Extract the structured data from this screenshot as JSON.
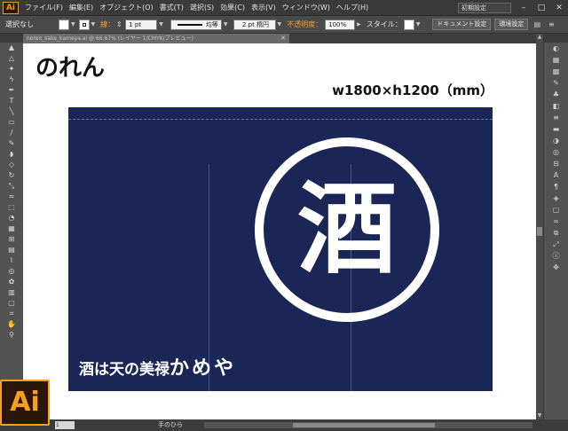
{
  "app": {
    "logo": "Ai"
  },
  "menubar": {
    "items": [
      "ファイル(F)",
      "編集(E)",
      "オブジェクト(O)",
      "書式(T)",
      "選択(S)",
      "効果(C)",
      "表示(V)",
      "ウィンドウ(W)",
      "ヘルプ(H)"
    ],
    "workspace": "初期設定",
    "minimize": "–",
    "maximize": "□",
    "close": "✕"
  },
  "controlbar": {
    "selection_status": "選択なし",
    "stroke_label": "線：",
    "stroke_weight": "1 pt",
    "brush_style": "均等",
    "brush_profile": "2 pt 楕円",
    "opacity_label": "不透明度：",
    "opacity_value": "100%",
    "style_label": "スタイル：",
    "document_setup": "ドキュメント設定",
    "preferences": "環境設定"
  },
  "document": {
    "tab_title": "noren_sake_kameya.ai @ 66.67% (レイヤー 1/CMYK/プレビュー)",
    "artboard_title": "のれん",
    "size_label": "w1800×h1200（mm）",
    "noren": {
      "emblem_char": "酒",
      "slogan": "酒は天の美禄",
      "shop_name": "かめや",
      "cloth_color": "#1a2756"
    }
  },
  "statusbar": {
    "zoom": "1",
    "current_tool": "手のひら"
  },
  "toolbox": {
    "tools": [
      {
        "name": "selection-tool-icon",
        "glyph": "▲"
      },
      {
        "name": "direct-selection-tool-icon",
        "glyph": "△"
      },
      {
        "name": "magic-wand-tool-icon",
        "glyph": "✦"
      },
      {
        "name": "lasso-tool-icon",
        "glyph": "ϟ"
      },
      {
        "name": "pen-tool-icon",
        "glyph": "✒"
      },
      {
        "name": "type-tool-icon",
        "glyph": "T"
      },
      {
        "name": "line-tool-icon",
        "glyph": "╲"
      },
      {
        "name": "rectangle-tool-icon",
        "glyph": "▭"
      },
      {
        "name": "paintbrush-tool-icon",
        "glyph": "∕"
      },
      {
        "name": "pencil-tool-icon",
        "glyph": "✎"
      },
      {
        "name": "blob-brush-tool-icon",
        "glyph": "◗"
      },
      {
        "name": "eraser-tool-icon",
        "glyph": "◇"
      },
      {
        "name": "rotate-tool-icon",
        "glyph": "↻"
      },
      {
        "name": "scale-tool-icon",
        "glyph": "⤡"
      },
      {
        "name": "warp-tool-icon",
        "glyph": "≈"
      },
      {
        "name": "free-transform-tool-icon",
        "glyph": "⬚"
      },
      {
        "name": "shape-builder-tool-icon",
        "glyph": "◔"
      },
      {
        "name": "perspective-grid-tool-icon",
        "glyph": "▦"
      },
      {
        "name": "mesh-tool-icon",
        "glyph": "⊞"
      },
      {
        "name": "gradient-tool-icon",
        "glyph": "▤"
      },
      {
        "name": "eyedropper-tool-icon",
        "glyph": "⌇"
      },
      {
        "name": "blend-tool-icon",
        "glyph": "◎"
      },
      {
        "name": "symbol-sprayer-tool-icon",
        "glyph": "✿"
      },
      {
        "name": "column-graph-tool-icon",
        "glyph": "▥"
      },
      {
        "name": "artboard-tool-icon",
        "glyph": "▢"
      },
      {
        "name": "slice-tool-icon",
        "glyph": "⌗"
      },
      {
        "name": "hand-tool-icon",
        "glyph": "✋"
      },
      {
        "name": "zoom-tool-icon",
        "glyph": "⚲"
      }
    ]
  },
  "rightpanel": {
    "icons": [
      {
        "name": "color-panel-icon",
        "glyph": "◐"
      },
      {
        "name": "color-guide-panel-icon",
        "glyph": "▦"
      },
      {
        "name": "swatches-panel-icon",
        "glyph": "▩"
      },
      {
        "name": "brushes-panel-icon",
        "glyph": "✎"
      },
      {
        "name": "symbols-panel-icon",
        "glyph": "♣"
      },
      {
        "name": "graphic-styles-panel-icon",
        "glyph": "◧"
      },
      {
        "name": "stroke-panel-icon",
        "glyph": "≡"
      },
      {
        "name": "gradient-panel-icon",
        "glyph": "▬"
      },
      {
        "name": "transparency-panel-icon",
        "glyph": "◑"
      },
      {
        "name": "appearance-panel-icon",
        "glyph": "◎"
      },
      {
        "name": "align-panel-icon",
        "glyph": "⊟"
      },
      {
        "name": "character-panel-icon",
        "glyph": "A"
      },
      {
        "name": "paragraph-panel-icon",
        "glyph": "¶"
      },
      {
        "name": "layers-panel-icon",
        "glyph": "◈"
      },
      {
        "name": "artboards-panel-icon",
        "glyph": "▢"
      },
      {
        "name": "links-panel-icon",
        "glyph": "∞"
      },
      {
        "name": "pathfinder-panel-icon",
        "glyph": "⧉"
      },
      {
        "name": "transform-panel-icon",
        "glyph": "⤢"
      },
      {
        "name": "info-panel-icon",
        "glyph": "ⓘ"
      },
      {
        "name": "navigator-panel-icon",
        "glyph": "✥"
      }
    ]
  }
}
